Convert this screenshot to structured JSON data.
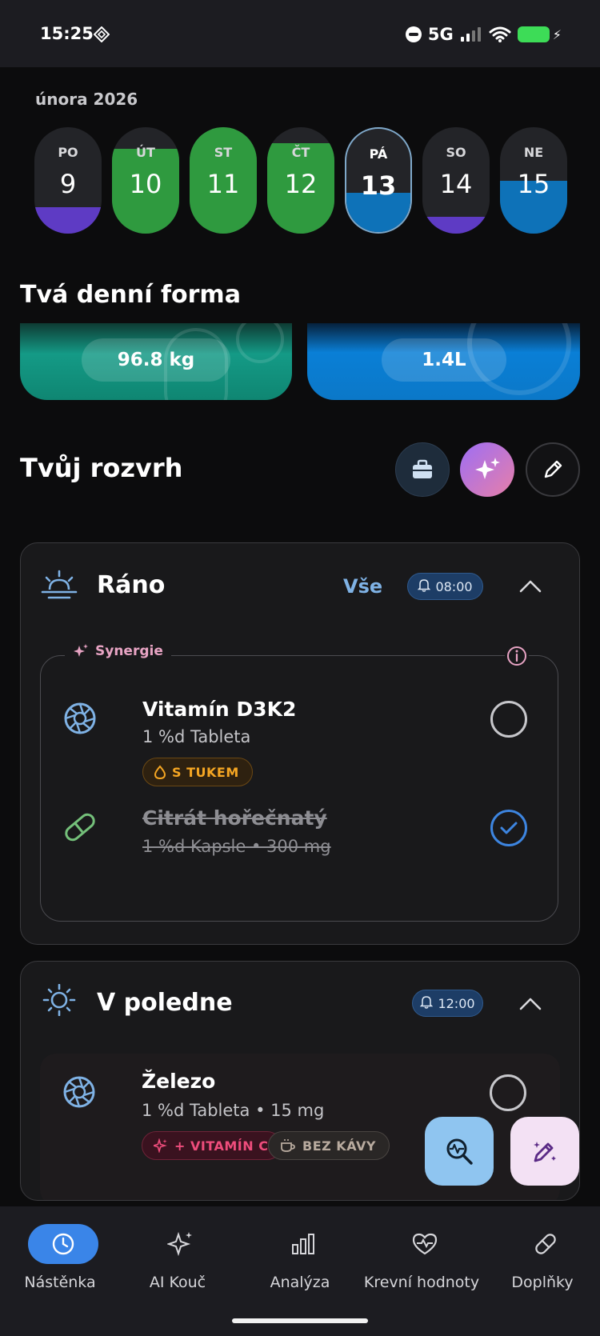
{
  "status_bar": {
    "time": "15:25",
    "network": "5G",
    "icons": [
      "diamond-icon",
      "do-not-disturb-icon",
      "signal-icon",
      "wifi-icon",
      "battery-charging-icon"
    ],
    "battery_color": "#3ddc57"
  },
  "calendar": {
    "month": "února 2026",
    "days": [
      {
        "name": "PO",
        "number": "9",
        "fill_color": "#5e3bc4",
        "fill_level": 0.25
      },
      {
        "name": "ÚT",
        "number": "10",
        "fill_color": "#2f9a3f",
        "fill_level": 0.8
      },
      {
        "name": "ST",
        "number": "11",
        "fill_color": "#2f9a3f",
        "fill_level": 1.0
      },
      {
        "name": "ČT",
        "number": "12",
        "fill_color": "#2f9a3f",
        "fill_level": 0.85
      },
      {
        "name": "PÁ",
        "number": "13",
        "fill_color": "#0e72b8",
        "fill_level": 0.38,
        "selected": true
      },
      {
        "name": "SO",
        "number": "14",
        "fill_color": "#5e3bc4",
        "fill_level": 0.16
      },
      {
        "name": "NE",
        "number": "15",
        "fill_color": "#0e72b8",
        "fill_level": 0.5
      }
    ]
  },
  "daily_form": {
    "title": "Tvá denní forma",
    "weight": "96.8 kg",
    "water": "1.4L"
  },
  "schedule": {
    "title": "Tvůj rozvrh",
    "actions": [
      "bag-icon",
      "ai-sparkle-icon",
      "pencil-icon"
    ],
    "sections": [
      {
        "title": "Ráno",
        "all_label": "Vše",
        "time": "08:00",
        "synergy_label": "Synergie",
        "items": [
          {
            "name": "Vitamín D3K2",
            "detail": "1 %d Tableta",
            "tag": "S TUKEM",
            "done": false
          },
          {
            "name": "Citrát hořečnatý",
            "detail": "1 %d Kapsle  •  300 mg",
            "done": true
          }
        ]
      },
      {
        "title": "V poledne",
        "time": "12:00",
        "items": [
          {
            "name": "Železo",
            "detail": "1 %d Tableta  •  15 mg",
            "tags": [
              "+ VITAMÍN C",
              "BEZ KÁVY"
            ],
            "done": false
          }
        ]
      }
    ]
  },
  "nav": {
    "items": [
      {
        "label": "Nástěnka",
        "icon": "clock-icon",
        "active": true
      },
      {
        "label": "AI Kouč",
        "icon": "sparkle-icon",
        "active": false
      },
      {
        "label": "Analýza",
        "icon": "bar-chart-icon",
        "active": false
      },
      {
        "label": "Krevní hodnoty",
        "icon": "heart-pulse-icon",
        "active": false
      },
      {
        "label": "Doplňky",
        "icon": "pill-icon",
        "active": false
      }
    ]
  }
}
